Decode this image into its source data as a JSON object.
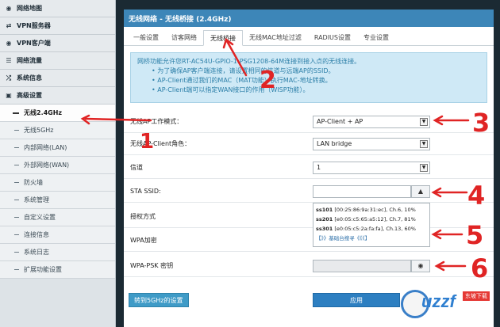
{
  "sidebar": {
    "items": [
      {
        "label": "网络地图",
        "icon": "globe-icon"
      },
      {
        "label": "VPN服务器",
        "icon": "vpn-icon"
      },
      {
        "label": "VPN客户端",
        "icon": "globe-icon"
      },
      {
        "label": "网络流量",
        "icon": "bars-icon"
      },
      {
        "label": "系统信息",
        "icon": "shuffle-icon"
      },
      {
        "label": "高级设置",
        "icon": "briefcase-icon"
      }
    ],
    "subitems": [
      {
        "label": "无线2.4GHz",
        "active": true
      },
      {
        "label": "无线5GHz"
      },
      {
        "label": "内部网络(LAN)"
      },
      {
        "label": "外部网络(WAN)"
      },
      {
        "label": "防火墙"
      },
      {
        "label": "系统管理"
      },
      {
        "label": "自定义设置"
      },
      {
        "label": "连接信息"
      },
      {
        "label": "系统日志"
      },
      {
        "label": "扩展功能设置"
      }
    ]
  },
  "main": {
    "title": "无线网络 - 无线桥接 (2.4GHz)",
    "tabs": [
      "一般设置",
      "访客网络",
      "无线桥接",
      "无线MAC地址过滤",
      "RADIUS设置",
      "专业设置"
    ],
    "active_tab": 2,
    "notice": {
      "line1": "网桥功能允许您RT-AC54U-GPIO-1-PSG1208-64M连接到接入点的无线连接。",
      "bullets": [
        "为了确保AP客户端连接，请设置相同的信道与远端AP的SSID。",
        "AP-Client通过我们的MAC（MAT功能）执行MAC-地址转换。",
        "AP-Client端可以指定WAN接口的作用（WISP功能）。"
      ]
    },
    "form": {
      "mode_label": "无线AP工作模式：",
      "mode_value": "AP-Client + AP",
      "role_label": "无线AP-Client角色：",
      "role_value": "LAN bridge",
      "channel_label": "信道",
      "channel_value": "1",
      "ssid_label": "STA SSID:",
      "ssid_value": "",
      "auth_label": "授权方式",
      "wpa_label": "WPA加密",
      "psk_label": "WPA-PSK 密钥",
      "psk_toggle_icon": "eye-icon"
    },
    "ssid_list": [
      {
        "name": "ss101",
        "detail": "[00:25:86:9a:31:ec], Ch.6, 10%"
      },
      {
        "name": "ss201",
        "detail": "[e0:05:c5:65:a5:12], Ch.7, 81%"
      },
      {
        "name": "ss301",
        "detail": "[e0:05:c5:2a:fa:fa], Ch.13, 60%"
      }
    ],
    "ssid_more": "【》》基础台搜寻《《《】",
    "buttons": {
      "goto_5g": "转到5GHz的设置",
      "apply": "应用"
    }
  },
  "annotations": [
    "1",
    "2",
    "3",
    "4",
    "5",
    "6"
  ],
  "watermark": {
    "text": "uzzf",
    "sub": "东坡下载"
  },
  "colors": {
    "accent": "#3d86b8",
    "annotation": "#e02424"
  }
}
